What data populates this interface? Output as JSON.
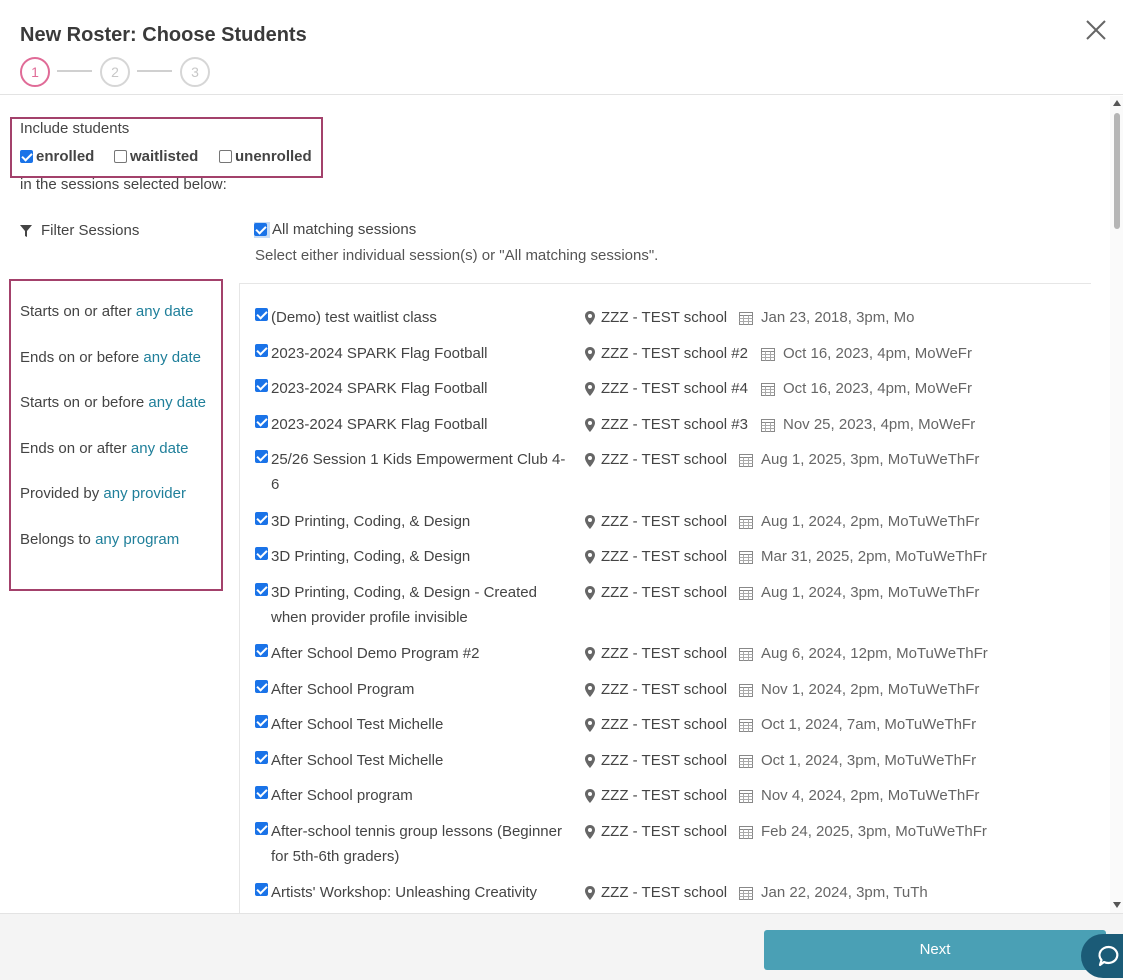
{
  "header": {
    "title": "New Roster: Choose Students",
    "steps": [
      "1",
      "2",
      "3"
    ]
  },
  "include": {
    "label": "Include students",
    "options": [
      {
        "label": "enrolled",
        "checked": true
      },
      {
        "label": "waitlisted",
        "checked": false
      },
      {
        "label": "unenrolled",
        "checked": false
      }
    ],
    "suffix": "in the sessions selected below:"
  },
  "filter": {
    "label": "Filter Sessions",
    "all_matching_label": "All matching sessions",
    "hint": "Select either individual session(s) or \"All matching sessions\".",
    "items": [
      {
        "prefix": "Starts on or after",
        "link": "any date"
      },
      {
        "prefix": "Ends on or before",
        "link": "any date"
      },
      {
        "prefix": "Starts on or before",
        "link": "any date"
      },
      {
        "prefix": "Ends on or after",
        "link": "any date"
      },
      {
        "prefix": "Provided by",
        "link": "any provider"
      },
      {
        "prefix": "Belongs to",
        "link": "any program"
      }
    ]
  },
  "sessions": [
    {
      "name": "(Demo) test waitlist class",
      "location": "ZZZ - TEST school",
      "date": "Jan 23, 2018, 3pm, Mo"
    },
    {
      "name": "2023-2024 SPARK Flag Football",
      "location": "ZZZ - TEST school #2",
      "date": "Oct 16, 2023, 4pm, MoWeFr"
    },
    {
      "name": "2023-2024 SPARK Flag Football",
      "location": "ZZZ - TEST school #4",
      "date": "Oct 16, 2023, 4pm, MoWeFr"
    },
    {
      "name": "2023-2024 SPARK Flag Football",
      "location": "ZZZ - TEST school #3",
      "date": "Nov 25, 2023, 4pm, MoWeFr"
    },
    {
      "name": "25/26 Session 1 Kids Empowerment Club 4-6",
      "location": "ZZZ - TEST school",
      "date": "Aug 1, 2025, 3pm, MoTuWeThFr"
    },
    {
      "name": "3D Printing, Coding, & Design",
      "location": "ZZZ - TEST school",
      "date": "Aug 1, 2024, 2pm, MoTuWeThFr"
    },
    {
      "name": "3D Printing, Coding, & Design",
      "location": "ZZZ - TEST school",
      "date": "Mar 31, 2025, 2pm, MoTuWeThFr"
    },
    {
      "name": "3D Printing, Coding, & Design - Created when provider profile invisible",
      "location": "ZZZ - TEST school",
      "date": "Aug 1, 2024, 3pm, MoTuWeThFr"
    },
    {
      "name": "After School Demo Program #2",
      "location": "ZZZ - TEST school",
      "date": "Aug 6, 2024, 12pm, MoTuWeThFr"
    },
    {
      "name": "After School Program",
      "location": "ZZZ - TEST school",
      "date": "Nov 1, 2024, 2pm, MoTuWeThFr"
    },
    {
      "name": "After School Test Michelle",
      "location": "ZZZ - TEST school",
      "date": "Oct 1, 2024, 7am, MoTuWeThFr"
    },
    {
      "name": "After School Test Michelle",
      "location": "ZZZ - TEST school",
      "date": "Oct 1, 2024, 3pm, MoTuWeThFr"
    },
    {
      "name": "After School program",
      "location": "ZZZ - TEST school",
      "date": "Nov 4, 2024, 2pm, MoTuWeThFr"
    },
    {
      "name": "After-school tennis group lessons (Beginner for 5th-6th graders)",
      "location": "ZZZ - TEST school",
      "date": "Feb 24, 2025, 3pm, MoTuWeThFr"
    },
    {
      "name": "Artists' Workshop: Unleashing Creativity",
      "location": "ZZZ - TEST school",
      "date": "Jan 22, 2024, 3pm, TuTh"
    }
  ],
  "footer": {
    "next_label": "Next"
  },
  "colors": {
    "accent": "#e06b97",
    "link": "#1f7f9a",
    "highlight_border": "#a3416b",
    "button": "#4aa0b5",
    "checkbox": "#1a73e8"
  }
}
